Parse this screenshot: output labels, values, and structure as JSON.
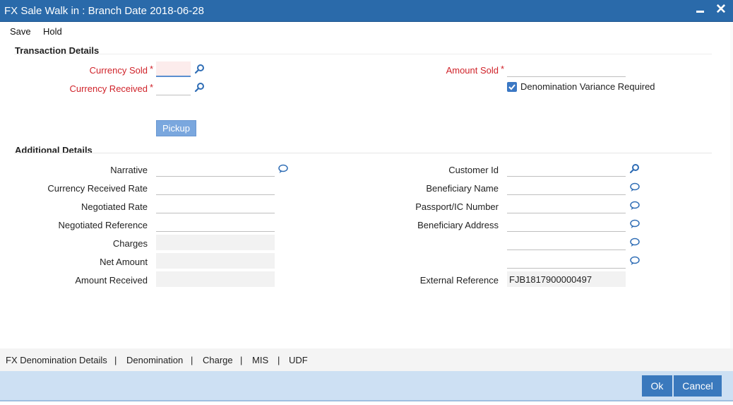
{
  "window": {
    "title": "FX Sale Walk in : Branch Date 2018-06-28",
    "minimize_icon": "minimize-icon",
    "close_icon": "close-icon",
    "close_glyph": "✕"
  },
  "menu": {
    "save": "Save",
    "hold": "Hold"
  },
  "transaction": {
    "heading": "Transaction Details",
    "currency_sold": {
      "label": "Currency Sold",
      "value": "",
      "required_mark": "*"
    },
    "currency_received": {
      "label": "Currency Received",
      "value": "",
      "required_mark": "*"
    },
    "amount_sold": {
      "label": "Amount Sold",
      "value": "",
      "required_mark": "*"
    },
    "denomination_variance": {
      "label": "Denomination Variance Required",
      "checked": true
    },
    "pickup_button": "Pickup"
  },
  "additional": {
    "heading": "Additional Details",
    "narrative": {
      "label": "Narrative",
      "value": ""
    },
    "currency_received_rate": {
      "label": "Currency Received Rate",
      "value": ""
    },
    "negotiated_rate": {
      "label": "Negotiated Rate",
      "value": ""
    },
    "negotiated_reference": {
      "label": "Negotiated Reference",
      "value": ""
    },
    "charges": {
      "label": "Charges",
      "value": ""
    },
    "net_amount": {
      "label": "Net Amount",
      "value": ""
    },
    "amount_received": {
      "label": "Amount Received",
      "value": ""
    },
    "customer_id": {
      "label": "Customer Id",
      "value": ""
    },
    "beneficiary_name": {
      "label": "Beneficiary Name",
      "value": ""
    },
    "passport_ic_number": {
      "label": "Passport/IC Number",
      "value": ""
    },
    "beneficiary_address": {
      "label": "Beneficiary Address",
      "value": "",
      "line2": "",
      "line3": ""
    },
    "external_reference": {
      "label": "External Reference",
      "value": "FJB1817900000497"
    }
  },
  "tabs": {
    "fx_denomination_details": "FX Denomination Details",
    "denomination": "Denomination",
    "charge": "Charge",
    "mis": "MIS",
    "udf": "UDF",
    "separator": "|"
  },
  "footer": {
    "ok": "Ok",
    "cancel": "Cancel"
  },
  "colors": {
    "titlebar": "#2a6aaa",
    "required": "#d0232a",
    "footer_bg": "#cde0f3",
    "button": "#3a79bd",
    "pickup_button": "#7aa7de"
  }
}
